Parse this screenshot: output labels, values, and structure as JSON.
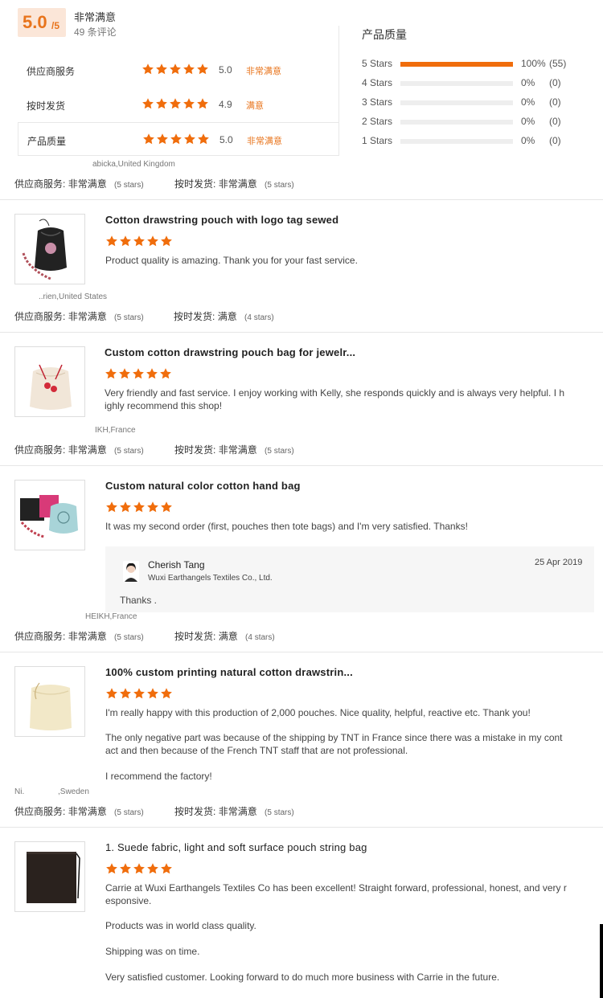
{
  "summary": {
    "score": "5.0",
    "score_suffix": "/5",
    "label": "非常满意",
    "reviews_count": "49 条评论",
    "metrics": [
      {
        "label": "供应商服务",
        "value": "5.0",
        "text": "非常满意",
        "stars": 5
      },
      {
        "label": "按时发货",
        "value": "4.9",
        "text": "满意",
        "stars": 5
      },
      {
        "label": "产品质量",
        "value": "5.0",
        "text": "非常满意",
        "stars": 5
      }
    ],
    "distribution_title": "产品质量",
    "distribution": [
      {
        "label": "5  Stars",
        "pct": "100%",
        "count": "(55)",
        "fraction": 1.0
      },
      {
        "label": "4  Stars",
        "pct": "0%",
        "count": "(0)",
        "fraction": 0
      },
      {
        "label": "3  Stars",
        "pct": "0%",
        "count": "(0)",
        "fraction": 0
      },
      {
        "label": "2  Stars",
        "pct": "0%",
        "count": "(0)",
        "fraction": 0
      },
      {
        "label": "1  Stars",
        "pct": "0%",
        "count": "(0)",
        "fraction": 0
      }
    ]
  },
  "ratings_labels": {
    "service": "供应商服务:",
    "shipping": "按时发货:",
    "very_satisfied": "非常满意",
    "satisfied": "满意",
    "five_stars": "(5 stars)",
    "four_stars": "(4 stars)"
  },
  "reviews": [
    {
      "reviewer": "abicka,United Kingdom",
      "service_text": "非常满意",
      "service_stars": "(5 stars)",
      "shipping_text": "非常满意",
      "shipping_stars": "(5 stars)"
    },
    {
      "title": "Cotton drawstring pouch with logo tag sewed",
      "text": "Product quality is amazing. Thank you for your fast service.",
      "reviewer": "..rien,United States",
      "service_text": "非常满意",
      "service_stars": "(5 stars)",
      "shipping_text": "满意",
      "shipping_stars": "(4 stars)"
    },
    {
      "title": "Custom cotton drawstring pouch bag for jewelr...",
      "text_lines": [
        "Very friendly and fast service. I enjoy working with Kelly, she responds quickly and is always very helpful. I h",
        "ighly recommend this shop!"
      ],
      "reviewer": "IKH,France",
      "service_text": "非常满意",
      "service_stars": "(5 stars)",
      "shipping_text": "非常满意",
      "shipping_stars": "(5 stars)"
    },
    {
      "title": "Custom natural color cotton hand bag",
      "text": "It was my second order (first, pouches then tote bags) and I'm very satisfied. Thanks!",
      "reply": {
        "name": "Cherish Tang",
        "company": "Wuxi Earthangels Textiles Co., Ltd.",
        "date": "25 Apr 2019",
        "text": "Thanks ."
      },
      "reviewer": "HEIKH,France",
      "service_text": "非常满意",
      "service_stars": "(5 stars)",
      "shipping_text": "满意",
      "shipping_stars": "(4 stars)"
    },
    {
      "title": "100% custom printing natural cotton drawstrin...",
      "text_1": "I'm really happy with this production of 2,000 pouches. Nice quality, helpful, reactive etc. Thank you!",
      "text_2_lines": [
        "The only negative part was because of the shipping by TNT in France since there was a mistake in my cont",
        "act and then because of the French TNT staff that are not professional."
      ],
      "text_3": "I recommend the factory!",
      "reviewer_a": "Ni.",
      "reviewer_b": ",Sweden",
      "service_text": "非常满意",
      "service_stars": "(5 stars)",
      "shipping_text": "非常满意",
      "shipping_stars": "(5 stars)"
    },
    {
      "title": "1. Suede fabric, light and soft surface pouch string bag",
      "text_1_lines": [
        "Carrie at Wuxi Earthangels Textiles Co has been excellent! Straight forward, professional, honest, and very r",
        "esponsive."
      ],
      "text_2": "Products was in world class quality.",
      "text_3": "Shipping was on time.",
      "text_4": "Very satisfied customer. Looking forward to do much more business with Carrie in the future."
    }
  ],
  "colors": {
    "accent": "#e8741c",
    "star": "#f06d0c",
    "bar": "#f06d0c"
  }
}
